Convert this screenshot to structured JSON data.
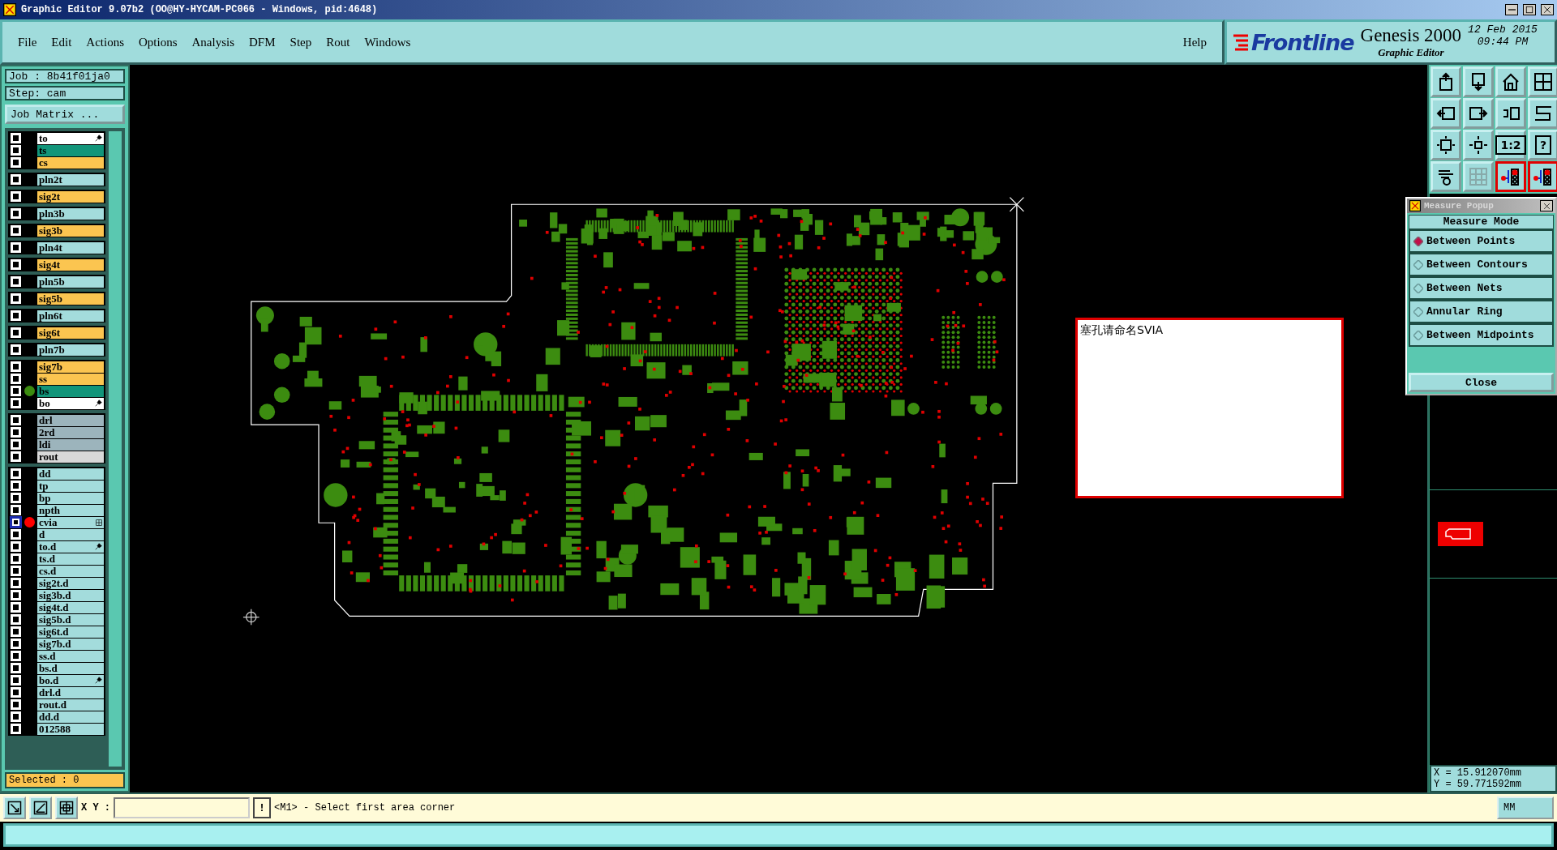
{
  "window": {
    "title": "Graphic Editor 9.07b2 (OO@HY-HYCAM-PC066 - Windows, pid:4648)"
  },
  "menu": [
    "File",
    "Edit",
    "Actions",
    "Options",
    "Analysis",
    "DFM",
    "Step",
    "Rout",
    "Windows"
  ],
  "help": "Help",
  "brand": {
    "logo": "Frontline",
    "product": "Genesis 2000",
    "subtitle": "Graphic Editor",
    "date": "12 Feb 2015",
    "time": "09:44 PM"
  },
  "job": {
    "job": "Job : 8b41f01ja0",
    "step": "Step: cam",
    "matrix_button": "Job Matrix ..."
  },
  "layer_groups": [
    [
      {
        "name": "to",
        "color": "#ffffff",
        "selected": false,
        "edit_mark": true
      },
      {
        "name": "ts",
        "color": "#12957a",
        "selected": false
      },
      {
        "name": "cs",
        "color": "#fbc550",
        "selected": false
      }
    ],
    [
      {
        "name": "pln2t",
        "color": "#a3dcdc",
        "selected": false
      }
    ],
    [
      {
        "name": "sig2t",
        "color": "#fbc550",
        "selected": false
      }
    ],
    [
      {
        "name": "pln3b",
        "color": "#a3dcdc",
        "selected": false
      }
    ],
    [
      {
        "name": "sig3b",
        "color": "#fbc550",
        "selected": false
      }
    ],
    [
      {
        "name": "pln4t",
        "color": "#a3dcdc",
        "selected": false
      }
    ],
    [
      {
        "name": "sig4t",
        "color": "#fbc550",
        "selected": false
      }
    ],
    [
      {
        "name": "pln5b",
        "color": "#a3dcdc",
        "selected": false
      }
    ],
    [
      {
        "name": "sig5b",
        "color": "#fbc550",
        "selected": false
      }
    ],
    [
      {
        "name": "pln6t",
        "color": "#a3dcdc",
        "selected": false
      }
    ],
    [
      {
        "name": "sig6t",
        "color": "#fbc550",
        "selected": false
      }
    ],
    [
      {
        "name": "pln7b",
        "color": "#a3dcdc",
        "selected": false
      }
    ],
    [
      {
        "name": "sig7b",
        "color": "#fbc550",
        "selected": false
      },
      {
        "name": "ss",
        "color": "#fbc550",
        "selected": false
      },
      {
        "name": "bs",
        "color": "#12957a",
        "selected": false,
        "dot": {
          "color": "#3c8c10"
        }
      },
      {
        "name": "bo",
        "color": "#ffffff",
        "selected": false,
        "edit_mark": true
      }
    ],
    [
      {
        "name": "drl",
        "color": "#9cb4bc",
        "selected": false
      },
      {
        "name": "2rd",
        "color": "#9cb4bc",
        "selected": false
      },
      {
        "name": "ldi",
        "color": "#9cb4bc",
        "selected": false
      },
      {
        "name": "rout",
        "color": "#d8d8d8",
        "selected": false
      }
    ],
    [
      {
        "name": "dd",
        "color": "#a3dcdc",
        "selected": false
      },
      {
        "name": "tp",
        "color": "#a3dcdc",
        "selected": false
      },
      {
        "name": "bp",
        "color": "#a3dcdc",
        "selected": false
      },
      {
        "name": "npth",
        "color": "#a3dcdc",
        "selected": false
      },
      {
        "name": "cvia",
        "color": "#a3dcdc",
        "selected": true,
        "dot": {
          "color": "#ff0000"
        },
        "grid_mark": true
      },
      {
        "name": "d",
        "color": "#a3dcdc",
        "selected": false
      },
      {
        "name": "to.d",
        "color": "#a3dcdc",
        "selected": false,
        "edit_mark": true
      },
      {
        "name": "ts.d",
        "color": "#a3dcdc",
        "selected": false
      },
      {
        "name": "cs.d",
        "color": "#a3dcdc",
        "selected": false
      },
      {
        "name": "sig2t.d",
        "color": "#a3dcdc",
        "selected": false
      },
      {
        "name": "sig3b.d",
        "color": "#a3dcdc",
        "selected": false
      },
      {
        "name": "sig4t.d",
        "color": "#a3dcdc",
        "selected": false
      },
      {
        "name": "sig5b.d",
        "color": "#a3dcdc",
        "selected": false
      },
      {
        "name": "sig6t.d",
        "color": "#a3dcdc",
        "selected": false
      },
      {
        "name": "sig7b.d",
        "color": "#a3dcdc",
        "selected": false
      },
      {
        "name": "ss.d",
        "color": "#a3dcdc",
        "selected": false
      },
      {
        "name": "bs.d",
        "color": "#a3dcdc",
        "selected": false
      },
      {
        "name": "bo.d",
        "color": "#a3dcdc",
        "selected": false,
        "edit_mark": true
      },
      {
        "name": "drl.d",
        "color": "#a3dcdc",
        "selected": false
      },
      {
        "name": "rout.d",
        "color": "#a3dcdc",
        "selected": false
      },
      {
        "name": "dd.d",
        "color": "#a3dcdc",
        "selected": false
      },
      {
        "name": "012588",
        "color": "#a3dcdc",
        "selected": false
      }
    ]
  ],
  "selected_count": "Selected : 0",
  "note": "塞孔请命名SVIA",
  "toolbar": [
    {
      "kind": "up",
      "on": false
    },
    {
      "kind": "down",
      "on": false
    },
    {
      "kind": "home",
      "on": false
    },
    {
      "kind": "window",
      "on": false
    },
    {
      "kind": "left",
      "on": false
    },
    {
      "kind": "right",
      "on": false
    },
    {
      "kind": "undo",
      "on": false
    },
    {
      "kind": "curve",
      "on": false
    },
    {
      "kind": "expand",
      "on": false
    },
    {
      "kind": "move",
      "on": false
    },
    {
      "kind": "text",
      "label": "1:2",
      "on": false
    },
    {
      "kind": "text",
      "label": "?",
      "on": false
    },
    {
      "kind": "tools",
      "on": false
    },
    {
      "kind": "grid",
      "on": false
    },
    {
      "kind": "net",
      "on": true
    },
    {
      "kind": "net",
      "on": true
    }
  ],
  "measure_popup": {
    "title": "Measure Popup",
    "header": "Measure Mode",
    "options": [
      {
        "label": "Between Points",
        "selected": true
      },
      {
        "label": "Between Contours",
        "selected": false
      },
      {
        "label": "Between Nets",
        "selected": false
      },
      {
        "label": "Annular Ring",
        "selected": false
      },
      {
        "label": "Between Midpoints",
        "selected": false
      }
    ],
    "close": "Close"
  },
  "coordinates": {
    "x": "X = 15.912070mm",
    "y": "Y = 59.771592mm"
  },
  "bottom_bar": {
    "xy_label": "X Y :",
    "alert": "!",
    "message": "<M1> - Select first area corner",
    "units": "MM"
  }
}
